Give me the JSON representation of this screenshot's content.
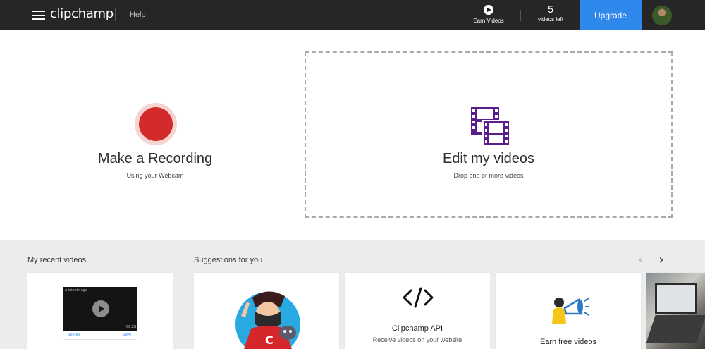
{
  "header": {
    "logo_text": "clipchamp",
    "help_label": "Help",
    "earn_videos_label": "Earn Videos",
    "videos_left_count": "5",
    "videos_left_label": "videos left",
    "upgrade_label": "Upgrade",
    "icons": [
      "hamburger-menu-icon",
      "play-circle-icon",
      "avatar"
    ]
  },
  "hero": {
    "record_title": "Make a Recording",
    "record_subtitle": "Using your Webcam",
    "edit_title": "Edit my videos",
    "edit_subtitle": "Drop one or more videos",
    "icons": [
      "record-icon",
      "film-strip-icon"
    ]
  },
  "recent": {
    "section_label": "My recent videos",
    "thumb_timestamp": "a minute ago",
    "thumb_duration": "00:23",
    "see_all_label": "See all",
    "save_label": "Save"
  },
  "suggestions": {
    "section_label": "Suggestions for you",
    "prev_arrow": "‹",
    "next_arrow": "›",
    "cards": [
      {
        "title": "",
        "subtitle": ""
      },
      {
        "title": "Clipchamp API",
        "subtitle": "Receive videos on your website"
      },
      {
        "title": "Earn free videos",
        "subtitle": ""
      }
    ]
  },
  "colors": {
    "header_bg": "#262626",
    "upgrade_blue": "#2f88ec",
    "record_red": "#d32b2b",
    "film_purple": "#5a1e8c",
    "lower_bg": "#ececec"
  }
}
